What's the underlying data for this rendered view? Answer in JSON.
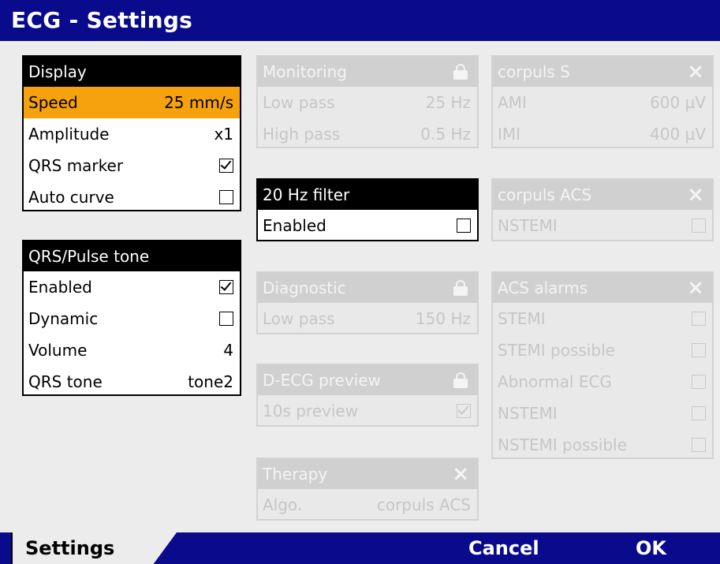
{
  "title": "ECG - Settings",
  "display": {
    "header": "Display",
    "speed_label": "Speed",
    "speed_value": "25 mm/s",
    "amplitude_label": "Amplitude",
    "amplitude_value": "x1",
    "qrs_marker_label": "QRS marker",
    "qrs_marker_checked": true,
    "auto_curve_label": "Auto curve",
    "auto_curve_checked": false
  },
  "pulse_tone": {
    "header": "QRS/Pulse tone",
    "enabled_label": "Enabled",
    "enabled_checked": true,
    "dynamic_label": "Dynamic",
    "dynamic_checked": false,
    "volume_label": "Volume",
    "volume_value": "4",
    "qrs_tone_label": "QRS tone",
    "qrs_tone_value": "tone2"
  },
  "monitoring": {
    "header": "Monitoring",
    "low_pass_label": "Low pass",
    "low_pass_value": "25 Hz",
    "high_pass_label": "High pass",
    "high_pass_value": "0.5 Hz"
  },
  "filter20": {
    "header": "20 Hz filter",
    "enabled_label": "Enabled",
    "enabled_checked": false
  },
  "diagnostic": {
    "header": "Diagnostic",
    "low_pass_label": "Low pass",
    "low_pass_value": "150 Hz"
  },
  "decg_preview": {
    "header": "D-ECG preview",
    "preview_label": "10s preview",
    "preview_checked": true
  },
  "therapy": {
    "header": "Therapy",
    "algo_label": "Algo.",
    "algo_value": "corpuls ACS"
  },
  "corpuls_s": {
    "header": "corpuls S",
    "ami_label": "AMI",
    "ami_value": "600 µV",
    "imi_label": "IMI",
    "imi_value": "400 µV"
  },
  "corpuls_acs": {
    "header": "corpuls ACS",
    "nstemi_label": "NSTEMI",
    "nstemi_checked": false
  },
  "acs_alarms": {
    "header": "ACS alarms",
    "items": [
      {
        "label": "STEMI",
        "checked": false
      },
      {
        "label": "STEMI possible",
        "checked": false
      },
      {
        "label": "Abnormal ECG",
        "checked": false
      },
      {
        "label": "NSTEMI",
        "checked": false
      },
      {
        "label": "NSTEMI possible",
        "checked": false
      }
    ]
  },
  "icons": {
    "lock": "lock-icon",
    "close": "close-icon"
  },
  "colors": {
    "titlebar": "#0a0a8c",
    "selected": "#f5a20e",
    "disabled_header": "#d0d0d0"
  },
  "bottom": {
    "tab_label": "Settings",
    "cancel_label": "Cancel",
    "ok_label": "OK"
  }
}
